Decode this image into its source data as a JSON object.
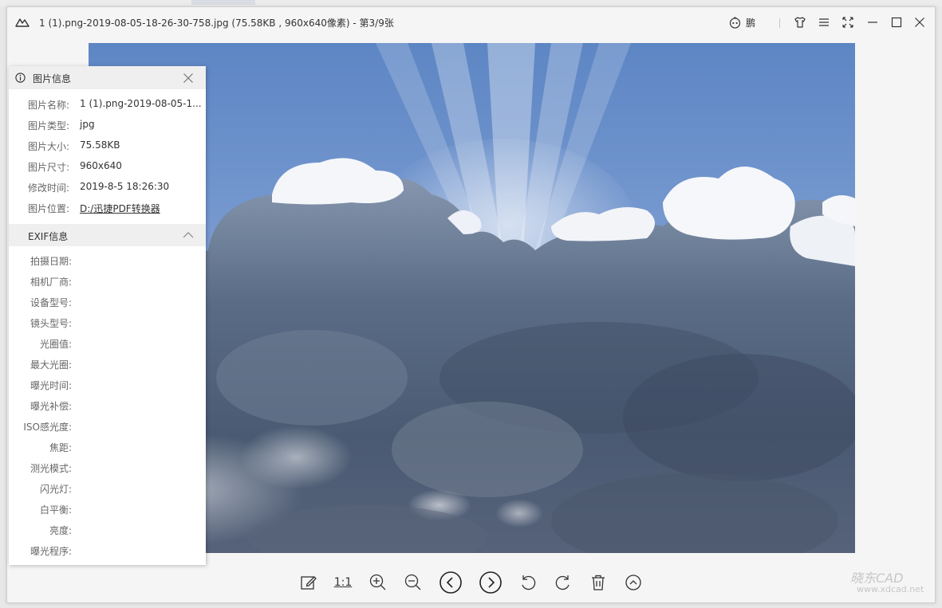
{
  "window": {
    "title": "1 (1).png-2019-08-05-18-26-30-758.jpg (75.58KB , 960x640像素) - 第3/9张",
    "user_name": "鹏"
  },
  "icons": {
    "app": "mountain-icon",
    "user": "robot-face-icon",
    "skin": "shirt-icon",
    "menu": "hamburger-menu-icon",
    "fullscreen": "fullscreen-icon",
    "minimize": "minimize-icon",
    "maximize": "maximize-icon",
    "close": "close-icon"
  },
  "info_panel": {
    "title": "图片信息",
    "rows": [
      {
        "label": "图片名称:",
        "value": "1 (1).png-2019-08-05-1..."
      },
      {
        "label": "图片类型:",
        "value": "jpg"
      },
      {
        "label": "图片大小:",
        "value": "75.58KB"
      },
      {
        "label": "图片尺寸:",
        "value": "960x640"
      },
      {
        "label": "修改时间:",
        "value": "2019-8-5 18:26:30"
      },
      {
        "label": "图片位置:",
        "value": "D:/迅捷PDF转换器"
      }
    ],
    "exif_title": "EXIF信息",
    "exif_rows": [
      "拍摄日期:",
      "相机厂商:",
      "设备型号:",
      "镜头型号:",
      "光圈值:",
      "最大光圈:",
      "曝光时间:",
      "曝光补偿:",
      "ISO感光度:",
      "焦距:",
      "测光模式:",
      "闪光灯:",
      "白平衡:",
      "亮度:",
      "曝光程序:"
    ]
  },
  "toolbar": {
    "one_to_one_label": "1:1"
  },
  "watermark": {
    "main": "晓东CAD",
    "sub": "www.xdcad.net"
  },
  "colors": {
    "sky_top": "#5d86c4",
    "cloud_dark": "#4a5a72",
    "cloud_light": "#f4f6fa"
  }
}
